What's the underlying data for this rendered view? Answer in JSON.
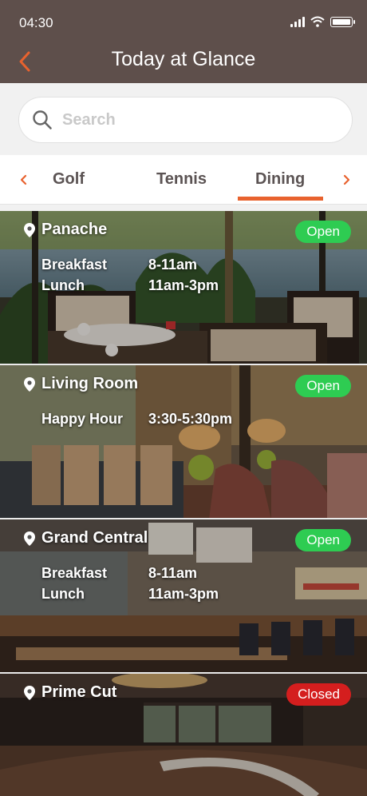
{
  "status_bar": {
    "time": "04:30"
  },
  "header": {
    "title": "Today at Glance",
    "back_icon": "chevron-left-icon"
  },
  "search": {
    "placeholder": "Search",
    "value": ""
  },
  "tabs": {
    "items": [
      {
        "label": "Golf",
        "active": false
      },
      {
        "label": "Tennis",
        "active": false
      },
      {
        "label": "Dining",
        "active": true
      }
    ],
    "accent": "#e8622e"
  },
  "venues": [
    {
      "name": "Panache",
      "status": "Open",
      "status_color": "#2ecc52",
      "hours": [
        {
          "label": "Breakfast",
          "time": "8-11am"
        },
        {
          "label": "Lunch",
          "time": "11am-3pm"
        }
      ]
    },
    {
      "name": "Living Room",
      "status": "Open",
      "status_color": "#2ecc52",
      "hours": [
        {
          "label": "Happy Hour",
          "time": "3:30-5:30pm"
        }
      ]
    },
    {
      "name": "Grand Central",
      "status": "Open",
      "status_color": "#2ecc52",
      "hours": [
        {
          "label": "Breakfast",
          "time": "8-11am"
        },
        {
          "label": "Lunch",
          "time": "11am-3pm"
        }
      ]
    },
    {
      "name": "Prime Cut",
      "status": "Closed",
      "status_color": "#d41e1e",
      "hours": []
    }
  ]
}
